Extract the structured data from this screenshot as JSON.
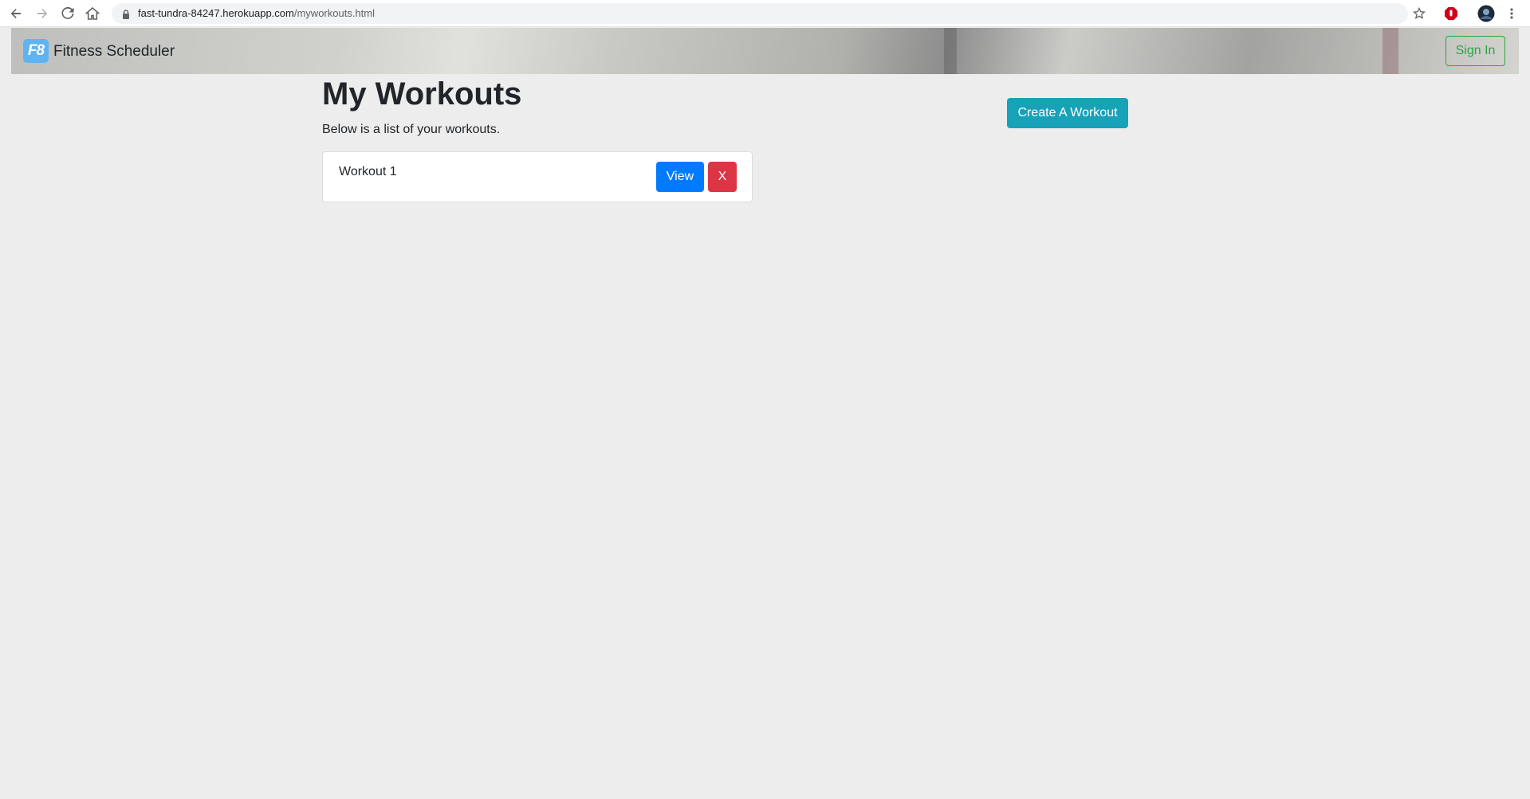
{
  "browser": {
    "url_host": "fast-tundra-84247.herokuapp.com",
    "url_path": "/myworkouts.html"
  },
  "navbar": {
    "logo_text": "F8",
    "brand": "Fitness Scheduler",
    "signin_label": "Sign In"
  },
  "main": {
    "title": "My Workouts",
    "subtitle": "Below is a list of your workouts.",
    "create_label": "Create A Workout",
    "workouts": [
      {
        "name": "Workout 1",
        "view_label": "View",
        "delete_label": "X"
      }
    ]
  },
  "colors": {
    "info": "#17a2b8",
    "primary": "#007bff",
    "danger": "#dc3545",
    "success": "#28a745",
    "background": "#ededed"
  }
}
